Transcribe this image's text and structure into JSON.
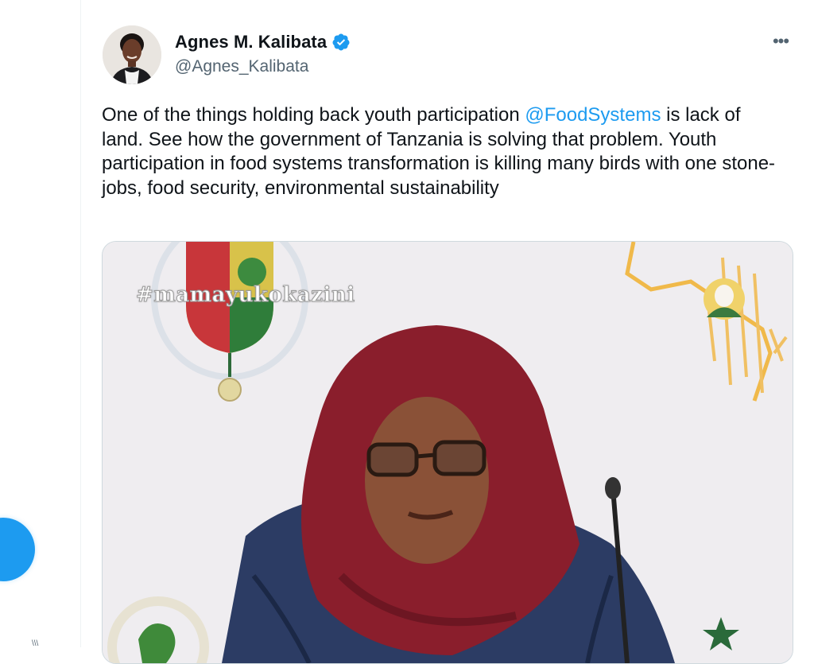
{
  "tweet": {
    "author_name": "Agnes M. Kalibata",
    "author_handle": "@Agnes_Kalibata",
    "more_label": "•••",
    "text_before_mention": "One of the things holding back youth participation ",
    "mention": "@FoodSystems",
    "text_after_mention": " is lack of land. See how the government of Tanzania is solving that problem. Youth participation in food systems transformation is killing many birds with one stone- jobs, food security, environmental sustainability",
    "media": {
      "overlay_hashtag": "#mamayukokazini"
    }
  },
  "colors": {
    "accent": "#1d9bf0",
    "text_primary": "#0f1419",
    "text_secondary": "#536471",
    "border": "#cfd9de"
  },
  "icons": [
    "verified-badge-icon",
    "more-options-icon",
    "compose-icon"
  ]
}
